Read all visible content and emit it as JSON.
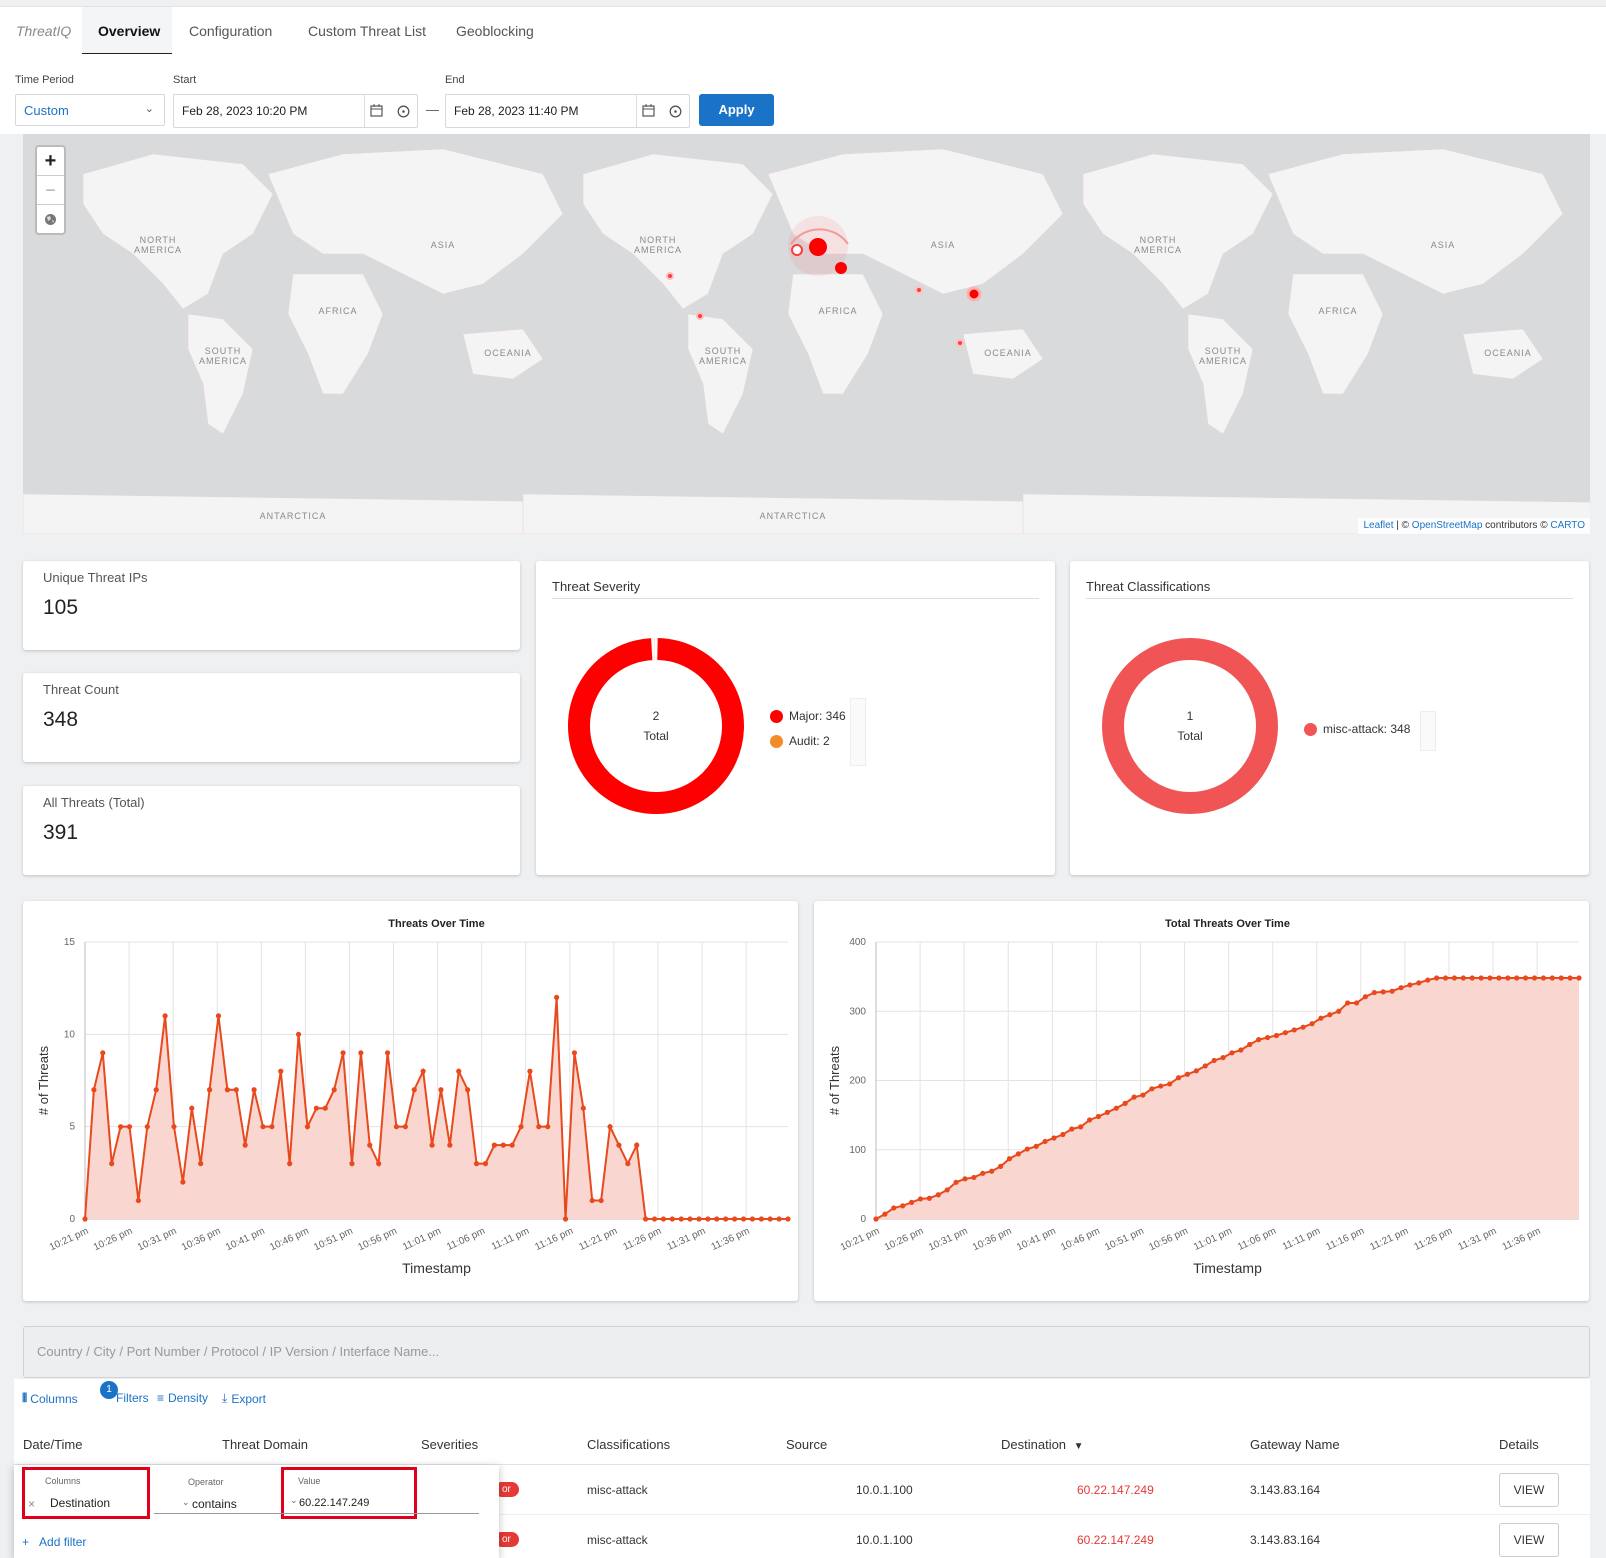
{
  "nav": {
    "brand": "ThreatIQ",
    "tabs": [
      "Overview",
      "Configuration",
      "Custom Threat List",
      "Geoblocking"
    ],
    "active_tab": "Overview"
  },
  "filters": {
    "time_period_label": "Time Period",
    "time_period_value": "Custom",
    "start_label": "Start",
    "start_value": "Feb 28, 2023 10:20 PM",
    "end_label": "End",
    "end_value": "Feb 28, 2023 11:40 PM",
    "dash": "—",
    "apply_label": "Apply"
  },
  "map": {
    "zoom_in": "+",
    "zoom_out": "−",
    "labels": [
      "NORTH AMERICA",
      "ASIA",
      "AFRICA",
      "SOUTH AMERICA",
      "OCEANIA",
      "ANTARCTICA"
    ],
    "attribution": {
      "leaflet": "Leaflet",
      "sep": " | © ",
      "osm": "OpenStreetMap",
      "contrib": " contributors © ",
      "carto": "CARTO"
    }
  },
  "stats": {
    "unique_ips_label": "Unique Threat IPs",
    "unique_ips_value": "105",
    "threat_count_label": "Threat Count",
    "threat_count_value": "348",
    "all_threats_label": "All Threats (Total)",
    "all_threats_value": "391"
  },
  "severity": {
    "title": "Threat Severity",
    "total_count": "2",
    "total_label": "Total",
    "items": [
      {
        "label": "Major: 346",
        "value": 346,
        "color": "#ff0000"
      },
      {
        "label": "Audit: 2",
        "value": 2,
        "color": "#f28c28"
      }
    ]
  },
  "classifications": {
    "title": "Threat Classifications",
    "total_count": "1",
    "total_label": "Total",
    "items": [
      {
        "label": "misc-attack: 348",
        "value": 348,
        "color": "#f05454"
      }
    ]
  },
  "chart_data": [
    {
      "type": "area",
      "title": "Threats Over Time",
      "xlabel": "Timestamp",
      "ylabel": "# of Threats",
      "ylim": [
        0,
        15
      ],
      "yticks": [
        0,
        5,
        10,
        15
      ],
      "xticks": [
        "10:21 pm",
        "10:26 pm",
        "10:31 pm",
        "10:36 pm",
        "10:41 pm",
        "10:46 pm",
        "10:51 pm",
        "10:56 pm",
        "11:01 pm",
        "11:06 pm",
        "11:11 pm",
        "11:16 pm",
        "11:21 pm",
        "11:26 pm",
        "11:31 pm",
        "11:36 pm"
      ],
      "color": "#e8491d",
      "fill": "#f9d7d0",
      "values": [
        0,
        7,
        9,
        3,
        5,
        5,
        1,
        5,
        7,
        11,
        5,
        2,
        6,
        3,
        7,
        11,
        7,
        7,
        4,
        7,
        5,
        5,
        8,
        3,
        10,
        5,
        6,
        6,
        7,
        9,
        3,
        9,
        4,
        3,
        9,
        5,
        5,
        7,
        8,
        4,
        7,
        4,
        8,
        7,
        3,
        3,
        4,
        4,
        4,
        5,
        8,
        5,
        5,
        12,
        0,
        9,
        6,
        1,
        1,
        5,
        4,
        3,
        4,
        0,
        0,
        0,
        0,
        0,
        0,
        0,
        0,
        0,
        0,
        0,
        0,
        0,
        0,
        0,
        0,
        0
      ]
    },
    {
      "type": "area",
      "title": "Total Threats Over Time",
      "xlabel": "Timestamp",
      "ylabel": "# of Threats",
      "ylim": [
        0,
        400
      ],
      "yticks": [
        0,
        100,
        200,
        300,
        400
      ],
      "xticks": [
        "10:21 pm",
        "10:26 pm",
        "10:31 pm",
        "10:36 pm",
        "10:41 pm",
        "10:46 pm",
        "10:51 pm",
        "10:56 pm",
        "11:01 pm",
        "11:06 pm",
        "11:11 pm",
        "11:16 pm",
        "11:21 pm",
        "11:26 pm",
        "11:31 pm",
        "11:36 pm"
      ],
      "color": "#e8491d",
      "fill": "#f9d7d0",
      "values": [
        0,
        7,
        16,
        19,
        24,
        29,
        30,
        35,
        42,
        53,
        58,
        60,
        66,
        69,
        76,
        87,
        94,
        101,
        105,
        112,
        117,
        122,
        130,
        133,
        143,
        148,
        154,
        160,
        167,
        176,
        179,
        188,
        192,
        195,
        204,
        209,
        214,
        221,
        229,
        233,
        240,
        244,
        252,
        259,
        262,
        265,
        269,
        273,
        277,
        282,
        290,
        295,
        300,
        312,
        312,
        321,
        327,
        328,
        329,
        334,
        338,
        341,
        345,
        348,
        348,
        348,
        348,
        348,
        348,
        348,
        348,
        348,
        348,
        348,
        348,
        348,
        348,
        348,
        348,
        348
      ]
    }
  ],
  "table": {
    "search_placeholder": "Country / City / Port Number / Protocol / IP Version / Interface Name...",
    "toolbar": {
      "columns": "Columns",
      "filters": "Filters",
      "filters_badge": "1",
      "density": "Density",
      "export": "Export"
    },
    "headers": [
      "Date/Time",
      "Threat Domain",
      "Severities",
      "Classifications",
      "Source",
      "Destination",
      "Gateway Name",
      "Details"
    ],
    "rows": [
      {
        "severity": "or",
        "classification": "misc-attack",
        "source": "10.0.1.100",
        "destination": "60.22.147.249",
        "gateway": "3.143.83.164",
        "details": "VIEW"
      },
      {
        "severity": "or",
        "classification": "misc-attack",
        "source": "10.0.1.100",
        "destination": "60.22.147.249",
        "gateway": "3.143.83.164",
        "details": "VIEW"
      }
    ],
    "filter_panel": {
      "columns_label": "Columns",
      "columns_value": "Destination",
      "operator_label": "Operator",
      "operator_value": "contains",
      "value_label": "Value",
      "value_value": "60.22.147.249",
      "add_filter": "Add filter",
      "remove": "×"
    }
  },
  "colors": {
    "accent": "#1b73c8",
    "danger": "#e53935",
    "highlight_box": "#e0001b"
  }
}
